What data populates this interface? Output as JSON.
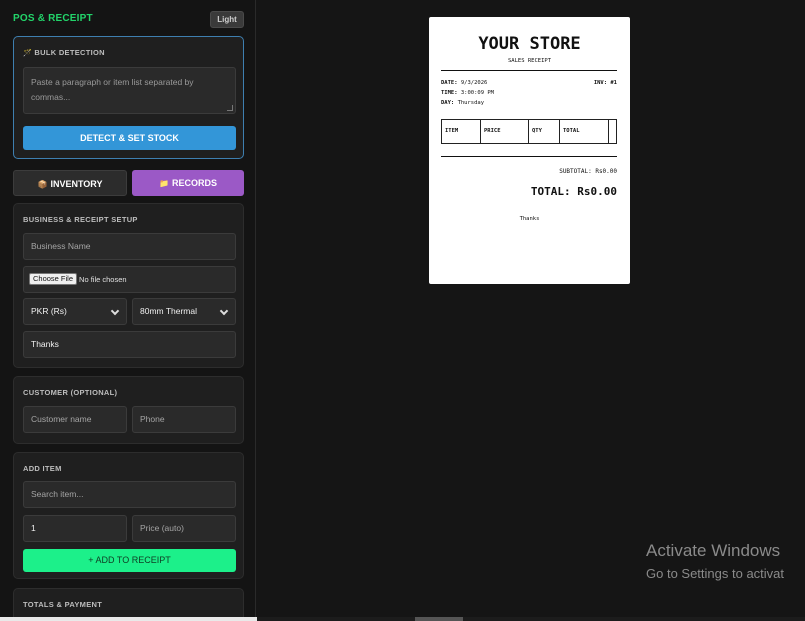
{
  "app": {
    "title": "POS & RECEIPT",
    "theme_toggle": "Light"
  },
  "bulk": {
    "title": "BULK DETECTION",
    "icon": "wand-icon",
    "placeholder": "Paste a paragraph or item list separated by commas...",
    "button": "DETECT & SET STOCK"
  },
  "tabs": {
    "inventory": {
      "label": "INVENTORY",
      "icon": "box-icon"
    },
    "records": {
      "label": "RECORDS",
      "icon": "folder-icon"
    }
  },
  "setup": {
    "title": "BUSINESS & RECEIPT SETUP",
    "business_placeholder": "Business Name",
    "file_button": "Choose File",
    "file_status": "No file chosen",
    "currency": "PKR (Rs)",
    "paper": "80mm Thermal",
    "footer_message": "Thanks"
  },
  "customer": {
    "title": "CUSTOMER (OPTIONAL)",
    "name_placeholder": "Customer name",
    "phone_placeholder": "Phone"
  },
  "add_item": {
    "title": "ADD ITEM",
    "search_placeholder": "Search item...",
    "quantity": "1",
    "price_placeholder": "Price (auto)",
    "button": "+ ADD TO RECEIPT"
  },
  "totals": {
    "title": "TOTALS & PAYMENT"
  },
  "receipt": {
    "store_name": "YOUR STORE",
    "subtitle": "SALES RECEIPT",
    "date_label": "DATE:",
    "date": "9/3/2026",
    "time_label": "TIME:",
    "time": "3:00:09 PM",
    "day_label": "DAY:",
    "day": "Thursday",
    "invoice": "INV: #1",
    "columns": [
      "ITEM",
      "PRICE",
      "QTY",
      "TOTAL"
    ],
    "subtotal": "SUBTOTAL: Rs0.00",
    "total": "TOTAL: Rs0.00",
    "footer": "Thanks"
  },
  "watermark": {
    "title": "Activate Windows",
    "subtitle": "Go to Settings to activat"
  }
}
